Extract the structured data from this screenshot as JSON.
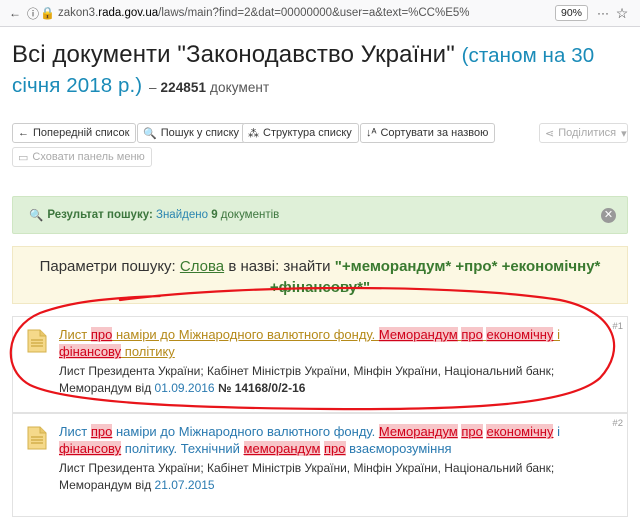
{
  "browser": {
    "url_prefix": "zakon3.",
    "url_domain": "rada.gov.ua",
    "url_rest": "/laws/main?find=2&dat=00000000&user=a&text=%CC%E5%",
    "zoom": "90%"
  },
  "header": {
    "title": "Всі документи \"Законодавство України\"",
    "as_of": "(станом на 30 січня 2018 р.)",
    "dash": "–",
    "count_number": "224851",
    "count_label": "документ"
  },
  "toolbar": {
    "prev_list": "Попередній список",
    "search_list": "Пошук у списку",
    "structure": "Структура списку",
    "sort": "Сортувати за назвою",
    "share": "Поділитися",
    "hide_menu": "Сховати панель меню"
  },
  "alert": {
    "label": "Результат пошуку:",
    "found": "Знайдено",
    "count": "9",
    "unit": "документів"
  },
  "params": {
    "prefix": "Параметри пошуку:",
    "field": "Слова",
    "mid": "в назві: знайти",
    "query": "\"+меморандум* +про* +економічну* +фінансову*\""
  },
  "results": [
    {
      "num": "#1",
      "t1": "Лист ",
      "t2": "про",
      "t3": " наміри до Міжнародного валютного фонду. ",
      "t4": "Меморандум",
      "t5": " ",
      "t6": "про",
      "t7": " ",
      "t8": "економічну",
      "t9": " і ",
      "t10": "фінансову",
      "t11": " політику",
      "issuers": "Лист Президента України; Кабінет Міністрів України, Мінфін України, Національний банк;",
      "doc_type": "Меморандум від",
      "date": "01.09.2016",
      "no_label": "№",
      "doc_no": "14168/0/2-16"
    },
    {
      "num": "#2",
      "t1": "Лист ",
      "t2": "про",
      "t3": " наміри до Міжнародного валютного фонду. ",
      "t4": "Меморандум",
      "t5": " ",
      "t6": "про",
      "t7": " ",
      "t8": "економічну",
      "t9": " і ",
      "t10": "фінансову",
      "t11": " політику. Технічний ",
      "t12": "меморандум",
      "t13": " ",
      "t14": "про",
      "t15": " взаєморозуміння",
      "issuers": "Лист Президента України; Кабінет Міністрів України, Мінфін України, Національний банк;",
      "doc_type": "Меморандум від",
      "date": "21.07.2015"
    }
  ],
  "colors": {
    "link": "#2a7ab0",
    "visited_link": "#b58a1a",
    "highlight_bg": "#f7c6c9",
    "highlight_text": "#d0021b",
    "annotation": "#e8141a"
  }
}
